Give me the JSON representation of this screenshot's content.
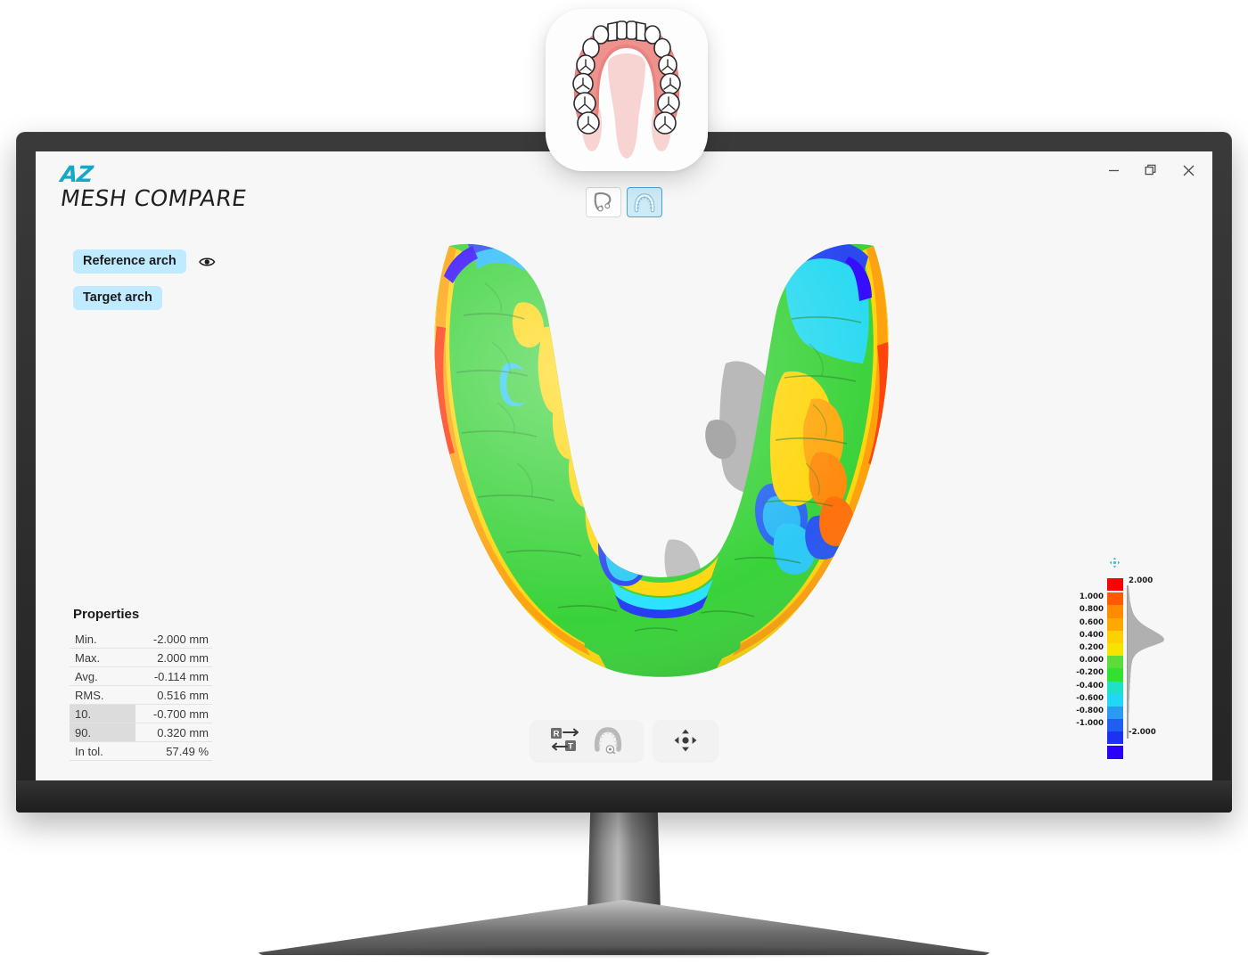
{
  "app": {
    "brand_top": "AZ",
    "brand_name": "MESH COMPARE",
    "accent_color": "#16a8c8",
    "chip_color": "#bfeaff"
  },
  "window_controls": [
    {
      "name": "minimize",
      "glyph": "–"
    },
    {
      "name": "restore",
      "glyph": "❐"
    },
    {
      "name": "close",
      "glyph": "✕"
    }
  ],
  "arch_toggle": {
    "options": [
      {
        "id": "lower-arch",
        "label": "Lower arch",
        "icon": "lower-arch-icon",
        "selected": false
      },
      {
        "id": "upper-arch",
        "label": "Upper arch",
        "icon": "upper-arch-icon",
        "selected": true
      }
    ]
  },
  "arch_list": {
    "items": [
      {
        "label": "Reference arch",
        "has_visibility_toggle": true,
        "visibility_icon": "eye-icon"
      },
      {
        "label": "Target arch",
        "has_visibility_toggle": false,
        "visibility_icon": ""
      }
    ]
  },
  "properties": {
    "title": "Properties",
    "rows": [
      {
        "key": "Min.",
        "value": "-2.000 mm",
        "highlighted": false
      },
      {
        "key": "Max.",
        "value": "2.000 mm",
        "highlighted": false
      },
      {
        "key": "Avg.",
        "value": "-0.114 mm",
        "highlighted": false
      },
      {
        "key": "RMS.",
        "value": "0.516 mm",
        "highlighted": false
      },
      {
        "key": "10.",
        "value": "-0.700 mm",
        "highlighted": true
      },
      {
        "key": "90.",
        "value": "0.320 mm",
        "highlighted": true
      },
      {
        "key": "In tol.",
        "value": "57.49 %",
        "highlighted": false
      }
    ]
  },
  "bottom_toolbar": {
    "groups": [
      {
        "buttons": [
          {
            "id": "swap-reference-target",
            "icon": "swap-r-t-icon"
          },
          {
            "id": "arch-occlusal-view",
            "icon": "arch-view-icon"
          }
        ]
      },
      {
        "buttons": [
          {
            "id": "pan-move",
            "icon": "move-arrows-icon"
          }
        ]
      }
    ]
  },
  "legend": {
    "move_icon": "move-handle-icon",
    "top_label": "2.000",
    "bottom_label": "-2.000",
    "tick_labels": [
      "1.000",
      "0.800",
      "0.600",
      "0.400",
      "0.200",
      "0.000",
      "-0.200",
      "-0.400",
      "-0.600",
      "-0.800",
      "-1.000"
    ],
    "swatch_colors": [
      "#ff0000",
      "#ff5a00",
      "#ff8c00",
      "#ffa800",
      "#ffd000",
      "#f4e400",
      "#5ddb3a",
      "#32e032",
      "#1fe0c8",
      "#22d6f5",
      "#2a9bf0",
      "#1f5ef0",
      "#1b32f0",
      "#2a00ff"
    ],
    "histogram": [
      2,
      3,
      3,
      4,
      4,
      5,
      5,
      6,
      6,
      7,
      8,
      9,
      10,
      12,
      13,
      15,
      17,
      20,
      24,
      28,
      33,
      39,
      46,
      54,
      63,
      72,
      80,
      88,
      95,
      99,
      100,
      96,
      84,
      70,
      56,
      44,
      34,
      27,
      22,
      18,
      15,
      13,
      12,
      11,
      10,
      10,
      9,
      9,
      8,
      8,
      8,
      7,
      7,
      7,
      6,
      6,
      6,
      6,
      5,
      5,
      5,
      5,
      5,
      4,
      4,
      4,
      4,
      4,
      4,
      4,
      3,
      3,
      3,
      3,
      3,
      3,
      3,
      3,
      3,
      3,
      3,
      3,
      3,
      3,
      3
    ]
  },
  "app_icon": {
    "name": "dental-arch-app-icon",
    "gum_color": "#e8837f",
    "gum_light": "#f2b9b6",
    "tooth_color": "#ffffff",
    "palate_color": "#f7d4d2"
  },
  "model": {
    "name": "dental-arch-deviation-map",
    "description": "3D mandibular arch colour deviation map"
  }
}
